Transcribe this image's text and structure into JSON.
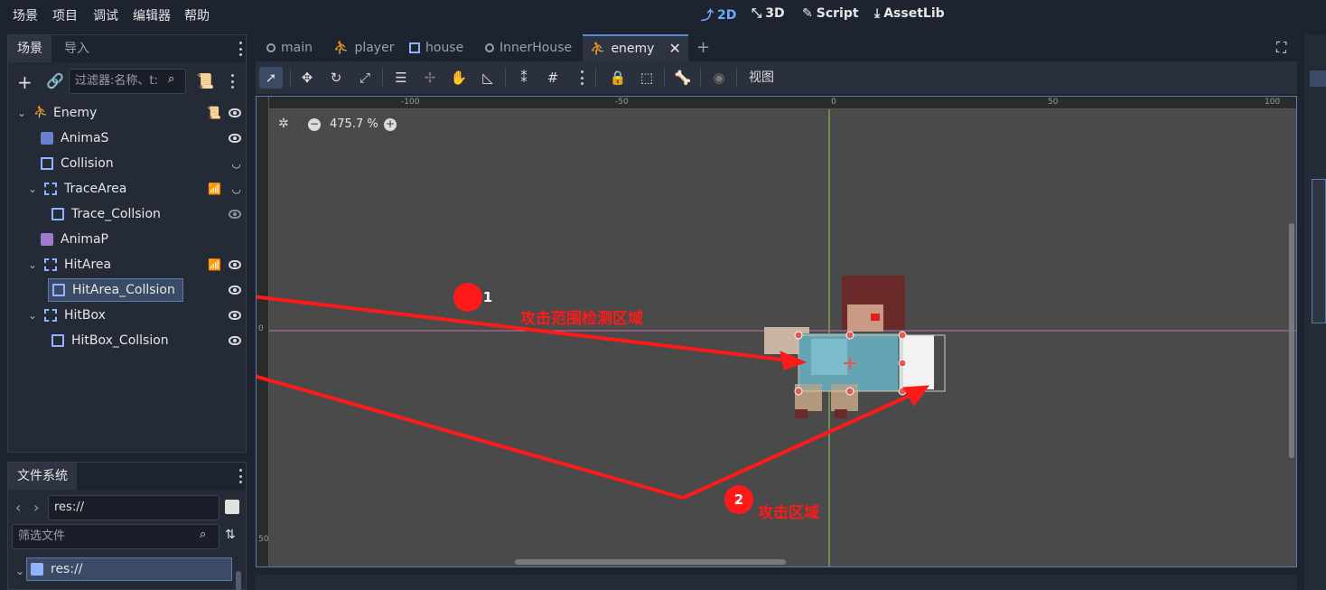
{
  "menu": [
    "场景",
    "项目",
    "调试",
    "编辑器",
    "帮助"
  ],
  "modes": {
    "m2d": "2D",
    "m3d": "3D",
    "script": "Script",
    "assetlib": "AssetLib"
  },
  "scene_dock": {
    "tab_scene": "场景",
    "tab_import": "导入",
    "filter_placeholder": "过滤器:名称、t:",
    "nodes": [
      {
        "label": "Enemy"
      },
      {
        "label": "AnimaS"
      },
      {
        "label": "Collision"
      },
      {
        "label": "TraceArea"
      },
      {
        "label": "Trace_Collsion"
      },
      {
        "label": "AnimaP"
      },
      {
        "label": "HitArea"
      },
      {
        "label": "HitArea_Collsion"
      },
      {
        "label": "HitBox"
      },
      {
        "label": "HitBox_Collsion"
      }
    ]
  },
  "fs_dock": {
    "tab": "文件系统",
    "path": "res://",
    "filter_placeholder": "筛选文件",
    "root": "res://"
  },
  "scene_tabs": [
    "main",
    "player",
    "house",
    "InnerHouse",
    "enemy"
  ],
  "toolbar": {
    "view": "视图"
  },
  "viewport": {
    "zoom": "475.7 %",
    "ruler_top": [
      "-100",
      "-50",
      "0",
      "50",
      "100"
    ],
    "ruler_left": [
      "0",
      "50"
    ]
  },
  "annotations": {
    "n1": "1",
    "t1": "攻击范围检测区域",
    "n2": "2",
    "t2": "攻击区域"
  },
  "colors": {
    "accent": "#6ea8ff",
    "arrow": "#ff1a1a",
    "bg": "#1e2330"
  }
}
